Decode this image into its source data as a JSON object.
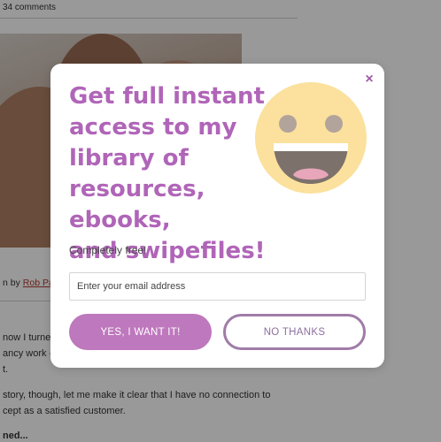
{
  "article": {
    "comments_count": "34 comments",
    "byline_prefix": "n by ",
    "byline_author": "Rob Pa",
    "paragraphs": [
      "now I turned",
      "ancy work -",
      "t.",
      " story, though, let me make it clear that I have no connection to",
      "cept as a satisfied customer.",
      "ned..."
    ]
  },
  "modal": {
    "headline_lines": [
      "Get full instant",
      "access to my",
      "library of",
      "resources, ebooks,",
      "and swipefiles!"
    ],
    "subtext": "Completely free!",
    "email_placeholder": "Enter your email address",
    "email_value": "",
    "yes_button": "YES, I WANT IT!",
    "no_button": "NO THANKS",
    "close_icon": "×"
  },
  "colors": {
    "accent": "#b065b8",
    "primary_button": "#be78bd",
    "secondary_border": "#a07ca8",
    "smiley_face": "#fbe19d",
    "smiley_features": "#b2a39b"
  }
}
